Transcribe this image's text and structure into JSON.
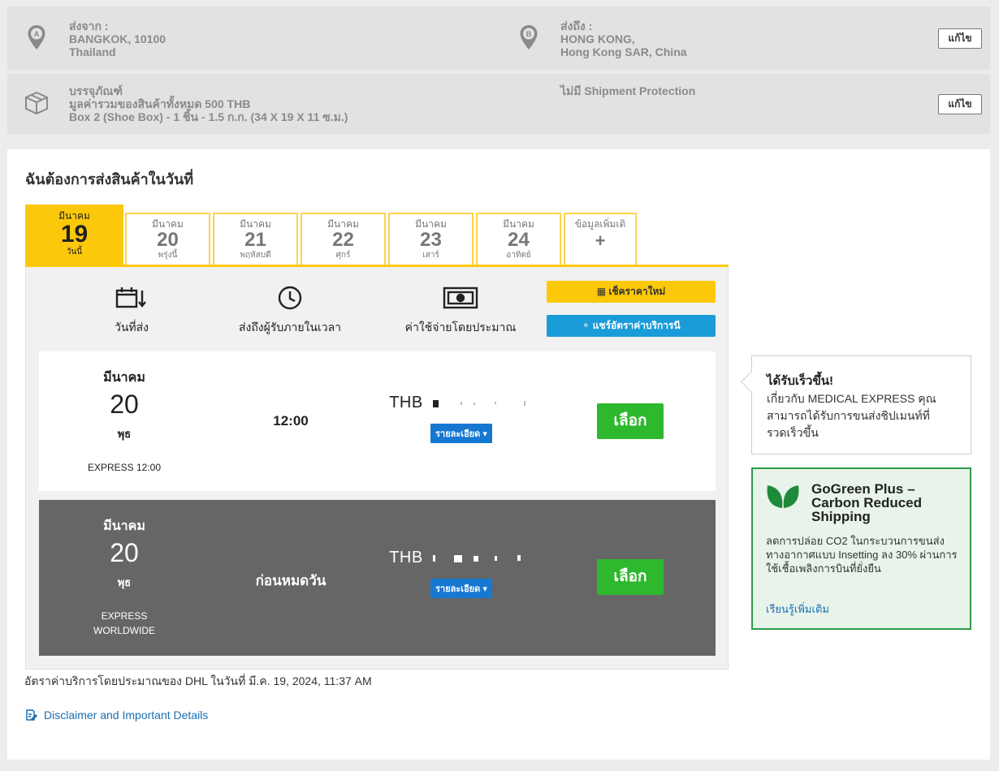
{
  "summary": {
    "origin": {
      "label": "ส่งจาก :",
      "line1": "BANGKOK, 10100",
      "line2": "Thailand",
      "marker": "A"
    },
    "destination": {
      "label": "ส่งถึง :",
      "line1": "HONG KONG,",
      "line2": "Hong Kong SAR, China",
      "marker": "B"
    },
    "package": {
      "label": "บรรจุภัณฑ์",
      "line1": "มูลค่ารวมของสินค้าทั้งหมด 500 THB",
      "line2": "Box 2 (Shoe Box) - 1 ชิ้น - 1.5 ก.ก. (34 X 19 X 11 ซ.ม.)"
    },
    "protection": "ไม่มี Shipment Protection",
    "edit_label": "แก้ไข"
  },
  "main": {
    "title": "ฉันต้องการส่งสินค้าในวันที่",
    "tabs": [
      {
        "month": "มีนาคม",
        "day": "19",
        "weekday": "วันนี้"
      },
      {
        "month": "มีนาคม",
        "day": "20",
        "weekday": "พรุ่งนี้"
      },
      {
        "month": "มีนาคม",
        "day": "21",
        "weekday": "พฤหัสบดี"
      },
      {
        "month": "มีนาคม",
        "day": "22",
        "weekday": "ศุกร์"
      },
      {
        "month": "มีนาคม",
        "day": "23",
        "weekday": "เสาร์"
      },
      {
        "month": "มีนาคม",
        "day": "24",
        "weekday": "อาทิตย์"
      },
      {
        "month": "ข้อมูลเพิ่มเติ",
        "day": "+",
        "weekday": ""
      }
    ],
    "headers": {
      "ship_date": "วันที่ส่ง",
      "delivery": "ส่งถึงผู้รับภายในเวลา",
      "cost": "ค่าใช้จ่ายโดยประมาณ"
    },
    "check_rates_label": "เช็คราคาใหม่",
    "share_label": "แชร์อัตราค่าบริการนี",
    "options": [
      {
        "month": "มีนาคม",
        "day": "20",
        "weekday": "พุธ",
        "service": "EXPRESS 12:00",
        "time": "12:00",
        "currency": "THB",
        "details": "รายละเอียด",
        "select": "เลือก"
      },
      {
        "month": "มีนาคม",
        "day": "20",
        "weekday": "พุธ",
        "service": "EXPRESS WORLDWIDE",
        "time": "ก่อนหมดวัน",
        "currency": "THB",
        "details": "รายละเอียด",
        "select": "เลือก"
      }
    ],
    "footer_note": "อัตราค่าบริการโดยประมาณของ DHL ในวันที่ มี.ค. 19, 2024, 11:37 AM",
    "disclaimer": "Disclaimer and Important Details"
  },
  "tip": {
    "title": "ได้รับเร็วขึ้น!",
    "body": "เกี่ยวกับ MEDICAL EXPRESS คุณสามารถได้รับการขนส่งชิปเมนท์ที่รวดเร็วขึ้น"
  },
  "green": {
    "title": "GoGreen Plus – Carbon Reduced Shipping",
    "body": "ลดการปล่อย CO2 ในกระบวนการขนส่งทางอากาศแบบ Insetting ลง 30% ผ่านการใช้เชื้อเพลิงการบินที่ยั่งยืน",
    "link": "เรียนรู้เพิ่มเติม"
  },
  "colors": {
    "dhl_yellow": "#fcc80a",
    "share_blue": "#1a9cd8",
    "select_green": "#2eb82e",
    "gogreen_border": "#2e9a4a"
  }
}
